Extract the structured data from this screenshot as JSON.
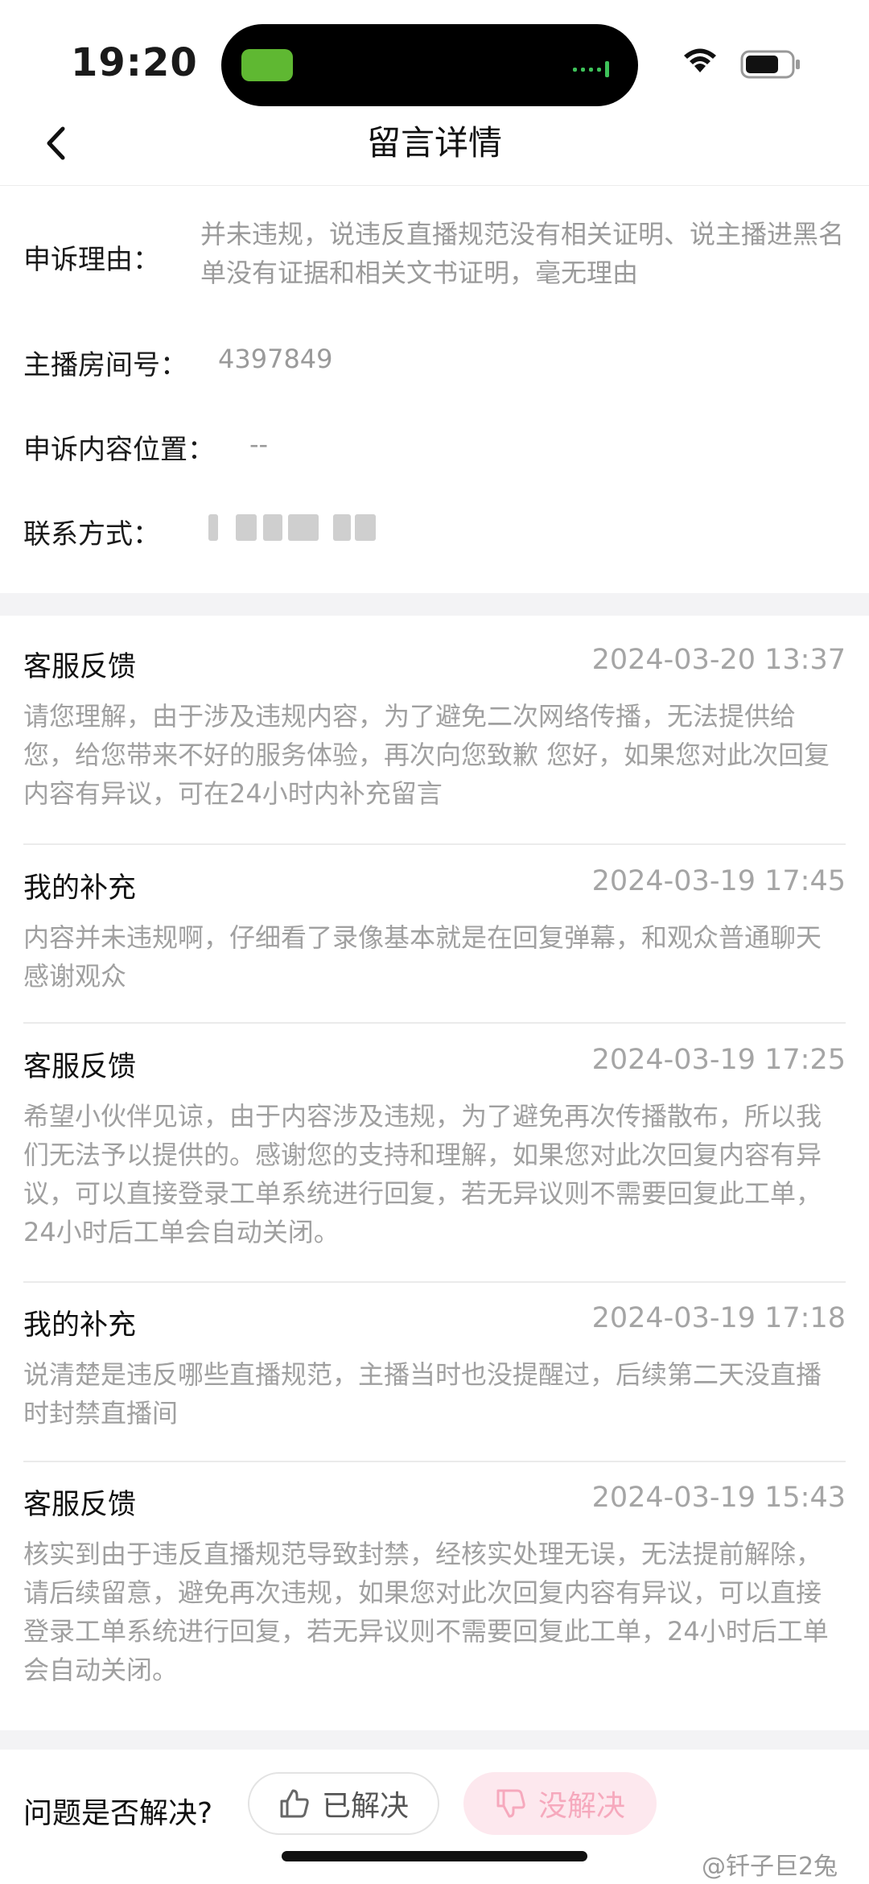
{
  "status": {
    "time": "19:20"
  },
  "nav": {
    "title": "留言详情"
  },
  "info": {
    "reason_label": "申诉理由：",
    "reason_text": "并未违规，说违反直播规范没有相关证明、说主播进黑名单没有证据和相关文书证明，毫无理由",
    "room_label": "主播房间号：",
    "room_value": "4397849",
    "position_label": "申诉内容位置：",
    "position_value": "--",
    "contact_label": "联系方式："
  },
  "messages": [
    {
      "title": "客服反馈",
      "time": "2024-03-20 13:37",
      "body": "请您理解，由于涉及违规内容，为了避免二次网络传播，无法提供给您，给您带来不好的服务体验，再次向您致歉 您好，如果您对此次回复内容有异议，可在24小时内补充留言"
    },
    {
      "title": "我的补充",
      "time": "2024-03-19 17:45",
      "body": "内容并未违规啊，仔细看了录像基本就是在回复弹幕，和观众普通聊天感谢观众"
    },
    {
      "title": "客服反馈",
      "time": "2024-03-19 17:25",
      "body": "希望小伙伴见谅，由于内容涉及违规，为了避免再次传播散布，所以我们无法予以提供的。感谢您的支持和理解，如果您对此次回复内容有异议，可以直接登录工单系统进行回复，若无异议则不需要回复此工单，24小时后工单会自动关闭。"
    },
    {
      "title": "我的补充",
      "time": "2024-03-19 17:18",
      "body": "说清楚是违反哪些直播规范，主播当时也没提醒过，后续第二天没直播时封禁直播间"
    },
    {
      "title": "客服反馈",
      "time": "2024-03-19 15:43",
      "body": "核实到由于违反直播规范导致封禁，经核实处理无误，无法提前解除，请后续留意，避免再次违规，如果您对此次回复内容有异议，可以直接登录工单系统进行回复，若无异议则不需要回复此工单，24小时后工单会自动关闭。"
    }
  ],
  "footer": {
    "question": "问题是否解决?",
    "resolved_label": "已解决",
    "unresolved_label": "没解决"
  },
  "watermark": "@钎子巨2兔",
  "colors": {
    "accent_pink": "#f6a9bd",
    "muted_text": "#a0a0a0"
  }
}
